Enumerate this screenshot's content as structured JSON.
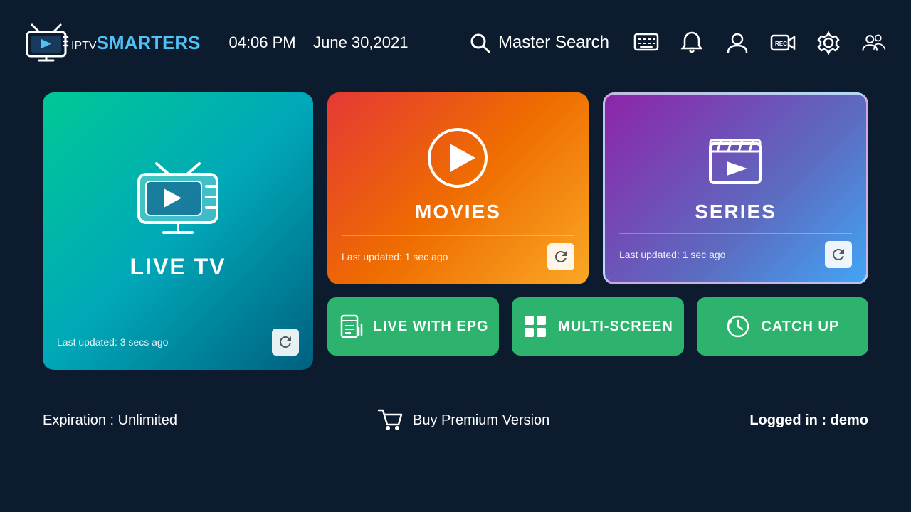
{
  "header": {
    "logo_iptv": "IPTV",
    "logo_smarters": "SMARTERS",
    "time": "04:06 PM",
    "date": "June 30,2021",
    "search_label": "Master Search"
  },
  "cards": {
    "live_tv": {
      "title": "LIVE TV",
      "last_updated": "Last updated: 3 secs ago"
    },
    "movies": {
      "title": "MOVIES",
      "last_updated": "Last updated: 1 sec ago"
    },
    "series": {
      "title": "SERIES",
      "last_updated": "Last updated: 1 sec ago"
    }
  },
  "bottom_buttons": {
    "epg": "LIVE WITH EPG",
    "multiscreen": "MULTI-SCREEN",
    "catchup": "CATCH UP"
  },
  "footer": {
    "expiration": "Expiration : Unlimited",
    "buy_premium": "Buy Premium Version",
    "logged_in_label": "Logged in : ",
    "logged_in_user": "demo"
  }
}
